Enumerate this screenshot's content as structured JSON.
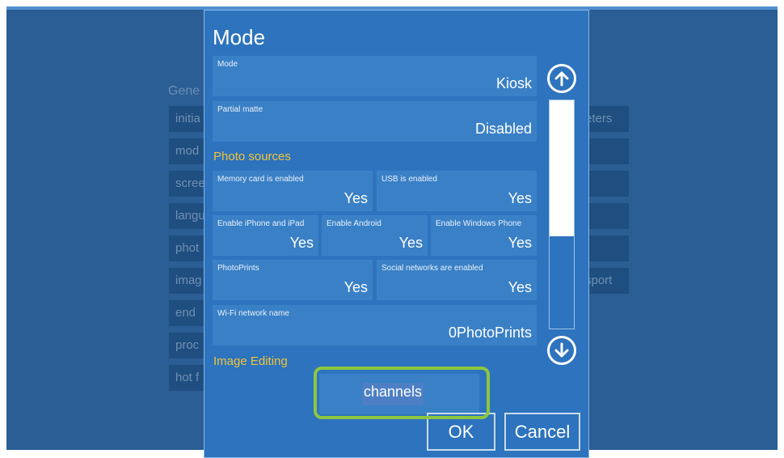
{
  "background": {
    "title": "Gene",
    "left_items": [
      "initia",
      "mod",
      "scree",
      "langu",
      "phot",
      "imag",
      "end",
      "proc",
      "hot f"
    ],
    "right_items": [
      "eters",
      "",
      "",
      "",
      "",
      "sport"
    ]
  },
  "dialog": {
    "title": "Mode",
    "mode": {
      "label": "Mode",
      "value": "Kiosk"
    },
    "partial_matte": {
      "label": "Partial matte",
      "value": "Disabled"
    },
    "photo_sources_header": "Photo sources",
    "memory_card": {
      "label": "Memory card is enabled",
      "value": "Yes"
    },
    "usb": {
      "label": "USB is enabled",
      "value": "Yes"
    },
    "iphone": {
      "label": "Enable iPhone and iPad",
      "value": "Yes"
    },
    "android": {
      "label": "Enable Android",
      "value": "Yes"
    },
    "windows_phone": {
      "label": "Enable Windows Phone",
      "value": "Yes"
    },
    "photoprints": {
      "label": "PhotoPrints",
      "value": "Yes"
    },
    "social": {
      "label": "Social networks are enabled",
      "value": "Yes"
    },
    "wifi": {
      "label": "Wi-Fi network name",
      "value": "0PhotoPrints"
    },
    "image_editing_header": "Image Editing",
    "channels_text": "channels",
    "ok_label": "OK",
    "cancel_label": "Cancel",
    "scroll_position": 0.0
  },
  "colors": {
    "dialog_bg": "#2d73bd",
    "field_bg": "#3a80c6",
    "section_header": "#f2c43a",
    "highlight_outline": "#8dc63f"
  }
}
